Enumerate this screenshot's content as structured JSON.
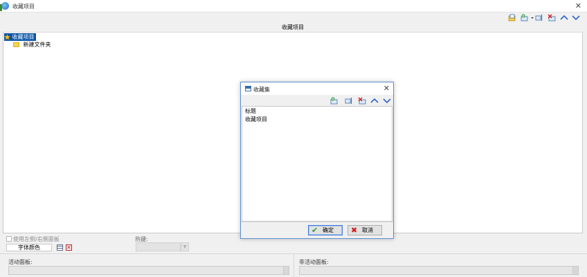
{
  "window": {
    "title": "收藏项目"
  },
  "column_header": "收藏项目",
  "tree": {
    "root": "收藏项目",
    "child": "新建文件夹"
  },
  "bottom": {
    "checkbox_label": "使用左侧/右侧面板",
    "font_button": "字体颜色",
    "hotkey_label": "热键:",
    "active_panel_label": "活动面板:",
    "inactive_panel_label": "非活动面板:"
  },
  "dialog": {
    "title": "收藏集",
    "items": [
      "标题",
      "收藏项目"
    ],
    "ok_label": "确定",
    "cancel_label": "取消"
  },
  "colors": {
    "selection": "#0a54a8",
    "accent_blue": "#3b78d8",
    "ok_green": "#2e9a2e",
    "cancel_red": "#d01818"
  }
}
